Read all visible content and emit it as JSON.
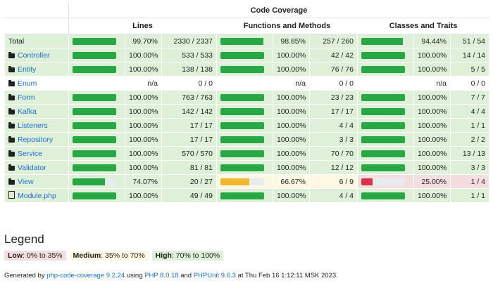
{
  "table": {
    "header_title": "Code Coverage",
    "col_lines": "Lines",
    "col_functions": "Functions and Methods",
    "col_classes": "Classes and Traits"
  },
  "rows": [
    {
      "name": "Total",
      "type": "total",
      "lines": {
        "pct": "99.70%",
        "num": "2330 / 2337",
        "level": "hi",
        "bar": 0.997
      },
      "funcs": {
        "pct": "98.85%",
        "num": "257 / 260",
        "level": "hi",
        "bar": 0.9885
      },
      "classes": {
        "pct": "94.44%",
        "num": "51 / 54",
        "level": "hi",
        "bar": 0.9444
      }
    },
    {
      "name": "Controller",
      "type": "folder",
      "lines": {
        "pct": "100.00%",
        "num": "533 / 533",
        "level": "hi",
        "bar": 1
      },
      "funcs": {
        "pct": "100.00%",
        "num": "42 / 42",
        "level": "hi",
        "bar": 1
      },
      "classes": {
        "pct": "100.00%",
        "num": "14 / 14",
        "level": "hi",
        "bar": 1
      }
    },
    {
      "name": "Entity",
      "type": "folder",
      "lines": {
        "pct": "100.00%",
        "num": "138 / 138",
        "level": "hi",
        "bar": 1
      },
      "funcs": {
        "pct": "100.00%",
        "num": "76 / 76",
        "level": "hi",
        "bar": 1
      },
      "classes": {
        "pct": "100.00%",
        "num": "5 / 5",
        "level": "hi",
        "bar": 1
      }
    },
    {
      "name": "Enum",
      "type": "folder",
      "lines": {
        "pct": "n/a",
        "num": "0 / 0",
        "level": "wh",
        "bar": null
      },
      "funcs": {
        "pct": "n/a",
        "num": "0 / 0",
        "level": "wh",
        "bar": null
      },
      "classes": {
        "pct": "n/a",
        "num": "0 / 0",
        "level": "wh",
        "bar": null
      }
    },
    {
      "name": "Form",
      "type": "folder",
      "lines": {
        "pct": "100.00%",
        "num": "763 / 763",
        "level": "hi",
        "bar": 1
      },
      "funcs": {
        "pct": "100.00%",
        "num": "23 / 23",
        "level": "hi",
        "bar": 1
      },
      "classes": {
        "pct": "100.00%",
        "num": "7 / 7",
        "level": "hi",
        "bar": 1
      }
    },
    {
      "name": "Kafka",
      "type": "folder",
      "lines": {
        "pct": "100.00%",
        "num": "142 / 142",
        "level": "hi",
        "bar": 1
      },
      "funcs": {
        "pct": "100.00%",
        "num": "17 / 17",
        "level": "hi",
        "bar": 1
      },
      "classes": {
        "pct": "100.00%",
        "num": "4 / 4",
        "level": "hi",
        "bar": 1
      }
    },
    {
      "name": "Listeners",
      "type": "folder",
      "lines": {
        "pct": "100.00%",
        "num": "17 / 17",
        "level": "hi",
        "bar": 1
      },
      "funcs": {
        "pct": "100.00%",
        "num": "4 / 4",
        "level": "hi",
        "bar": 1
      },
      "classes": {
        "pct": "100.00%",
        "num": "1 / 1",
        "level": "hi",
        "bar": 1
      }
    },
    {
      "name": "Repository",
      "type": "folder",
      "lines": {
        "pct": "100.00%",
        "num": "17 / 17",
        "level": "hi",
        "bar": 1
      },
      "funcs": {
        "pct": "100.00%",
        "num": "3 / 3",
        "level": "hi",
        "bar": 1
      },
      "classes": {
        "pct": "100.00%",
        "num": "2 / 2",
        "level": "hi",
        "bar": 1
      }
    },
    {
      "name": "Service",
      "type": "folder",
      "lines": {
        "pct": "100.00%",
        "num": "570 / 570",
        "level": "hi",
        "bar": 1
      },
      "funcs": {
        "pct": "100.00%",
        "num": "70 / 70",
        "level": "hi",
        "bar": 1
      },
      "classes": {
        "pct": "100.00%",
        "num": "13 / 13",
        "level": "hi",
        "bar": 1
      }
    },
    {
      "name": "Validator",
      "type": "folder",
      "lines": {
        "pct": "100.00%",
        "num": "81 / 81",
        "level": "hi",
        "bar": 1
      },
      "funcs": {
        "pct": "100.00%",
        "num": "12 / 12",
        "level": "hi",
        "bar": 1
      },
      "classes": {
        "pct": "100.00%",
        "num": "3 / 3",
        "level": "hi",
        "bar": 1
      }
    },
    {
      "name": "View",
      "type": "folder",
      "lines": {
        "pct": "74.07%",
        "num": "20 / 27",
        "level": "hi",
        "bar": 0.7407
      },
      "funcs": {
        "pct": "66.67%",
        "num": "6 / 9",
        "level": "med",
        "bar": 0.6667
      },
      "classes": {
        "pct": "25.00%",
        "num": "1 / 4",
        "level": "lo",
        "bar": 0.25
      }
    },
    {
      "name": "Module.php",
      "type": "file",
      "lines": {
        "pct": "100.00%",
        "num": "49 / 49",
        "level": "hi",
        "bar": 1
      },
      "funcs": {
        "pct": "100.00%",
        "num": "4 / 4",
        "level": "hi",
        "bar": 1
      },
      "classes": {
        "pct": "100.00%",
        "num": "1 / 1",
        "level": "hi",
        "bar": 1
      }
    }
  ],
  "legend": {
    "title": "Legend",
    "low_label": "Low",
    "low_range": ": 0% to 35%",
    "medium_label": "Medium",
    "medium_range": ": 35% to 70%",
    "high_label": "High",
    "high_range": ": 70% to 100%"
  },
  "footer": {
    "generated_by": "Generated by ",
    "tool_link": "php-code-coverage 9.2.24",
    "using": " using ",
    "php_link": "PHP 8.0.18",
    "and": " and ",
    "phpunit_link": "PHPUnit 9.6.3",
    "at": " at Thu Feb 16 1:12:11 MSK 2023."
  },
  "colors": {
    "high": "#dff0d8",
    "medium": "#fcf8e3",
    "low": "#f2dede",
    "bar_success": "#28a745",
    "bar_warning": "#f0b72f",
    "bar_danger": "#d9334a",
    "link": "#1a6fd1"
  }
}
